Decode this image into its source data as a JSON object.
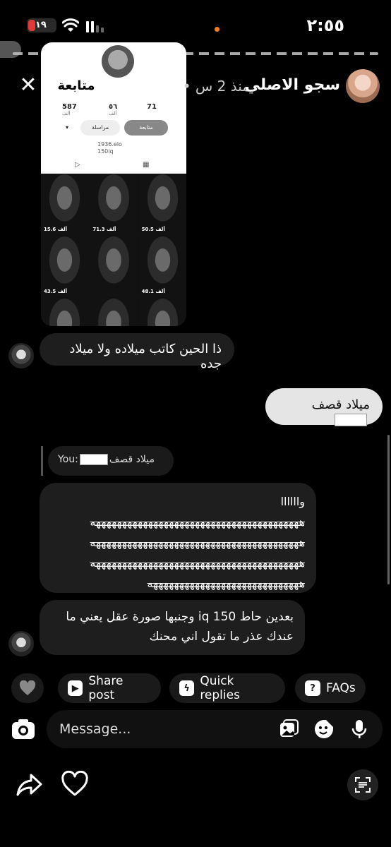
{
  "status_bar": {
    "time": "٢:٥٥",
    "battery_level": "١٩"
  },
  "header": {
    "username": "سجو الاصلي",
    "post_time": "• منذ 2 س",
    "follow_label": "متابعة"
  },
  "shared_post": {
    "stats": [
      {
        "value": "71",
        "label": ""
      },
      {
        "value": "٥٦",
        "label": "ألف"
      },
      {
        "value": "587",
        "label": "ألف"
      }
    ],
    "follow_label": "متابعة",
    "message_label": "مراسلة",
    "bio_line1": "1936.elo",
    "bio_line2": "150iq",
    "views": [
      "15.6 ألف",
      "71.3 ألف",
      "50.5 ألف",
      "43.5 ألف",
      "",
      "48.1 ألف",
      "",
      "",
      ""
    ]
  },
  "messages": {
    "first": "ذا الحين كاتب ميلاده ولا ميلاد جده",
    "sent": "ميلاد قصف",
    "reply_prefix": "You:",
    "reply_text": "ميلاد قصف",
    "long_first": "واااااا",
    "long_line": "ههههههههههههههههههههههههههههههههههههههههه",
    "long_last": "هههههههههههههههههههههههههههههه",
    "third": "بعدين حاط iq 150 وجنبها صورة عقل يعني ما عندك عذر ما تقول اني محنك"
  },
  "chips": {
    "share_post": "Share post",
    "quick_replies": "Quick replies",
    "faqs": "FAQs"
  },
  "composer": {
    "placeholder": "Message..."
  }
}
